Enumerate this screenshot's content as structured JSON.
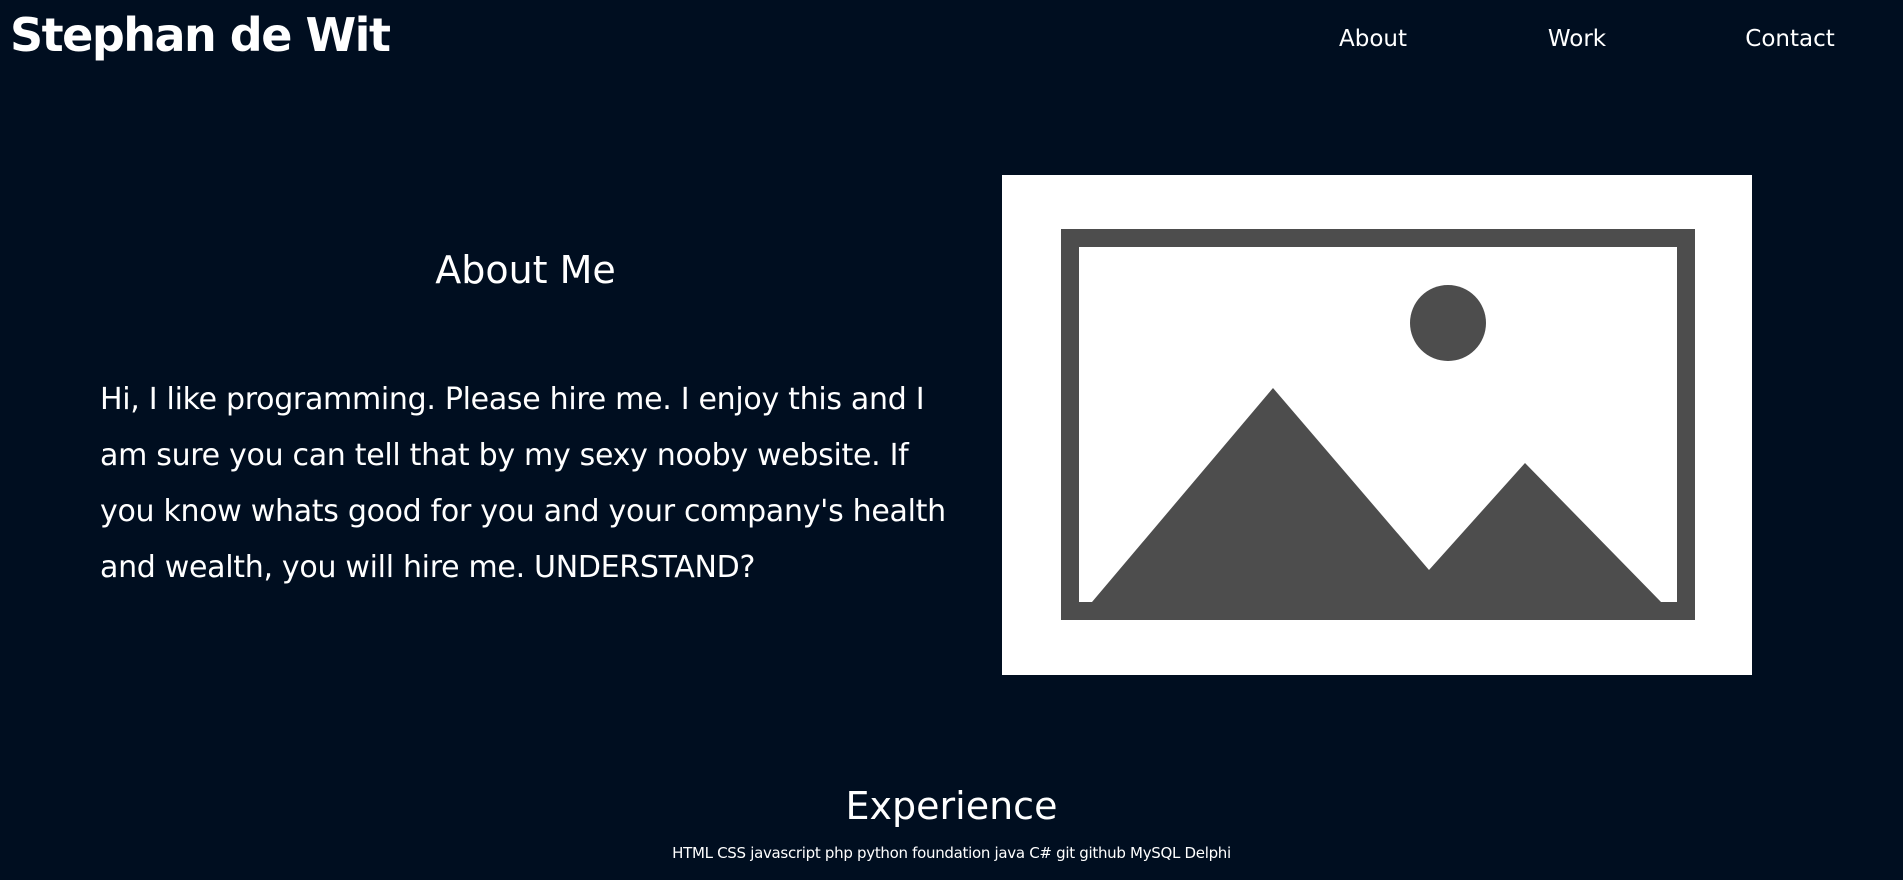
{
  "header": {
    "site_title": "Stephan de Wit",
    "nav": [
      {
        "label": "About"
      },
      {
        "label": "Work"
      },
      {
        "label": "Contact"
      }
    ]
  },
  "about": {
    "heading": "About Me",
    "text": "Hi, I like programming. Please hire me. I enjoy this and I am sure you can tell that by my sexy nooby website. If you know whats good for you and your company's health and wealth, you will hire me. UNDERSTAND?",
    "image_icon": "image-placeholder-icon"
  },
  "experience": {
    "heading": "Experience",
    "skills": "HTML CSS javascript php python foundation java C# git github MySQL Delphi"
  },
  "colors": {
    "background": "#000e20",
    "text": "#ffffff",
    "placeholder_gray": "#4d4d4d"
  }
}
